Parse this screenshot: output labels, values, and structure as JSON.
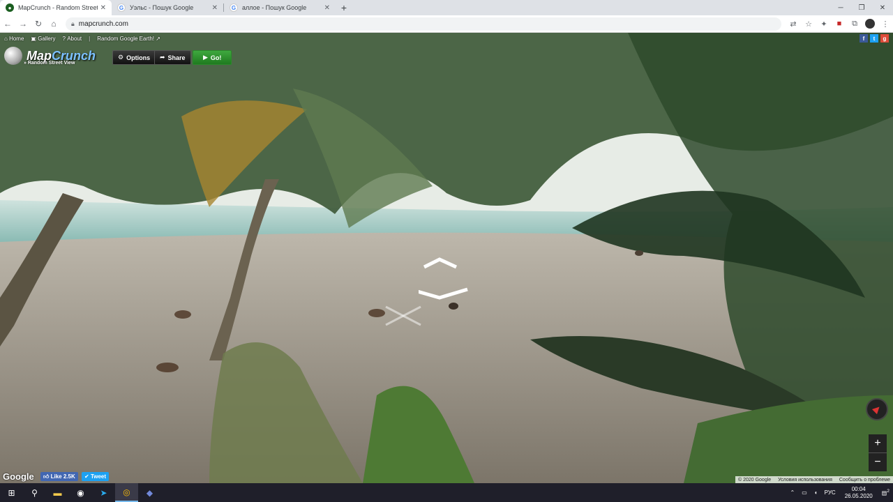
{
  "browser": {
    "tabs": [
      {
        "title": "MapCrunch - Random Street Vie",
        "favicon": "mapcrunch-icon"
      },
      {
        "title": "Уэльс - Пошук Google",
        "favicon": "google-icon"
      },
      {
        "title": "аллое - Пошук Google",
        "favicon": "google-icon"
      }
    ],
    "new_tab": "+",
    "url": "mapcrunch.com"
  },
  "mapcrunch": {
    "nav": {
      "home": "Home",
      "gallery": "Gallery",
      "about": "About",
      "earth": "Random Google Earth!"
    },
    "logo": {
      "map": "Map",
      "crunch": "Crunch",
      "sub": "» Random Street View"
    },
    "buttons": {
      "options": "Options",
      "share": "Share",
      "go": "Go!"
    }
  },
  "map_footer": {
    "google": "Google",
    "fb_like": "Like 2.5K",
    "tweet": "Tweet",
    "copyright": "© 2020 Google",
    "terms": "Условия использования",
    "report": "Сообщить о проблеме"
  },
  "taskbar": {
    "lang": "РУС",
    "time": "00:04",
    "date": "26.05.2020",
    "notification_count": "2"
  }
}
